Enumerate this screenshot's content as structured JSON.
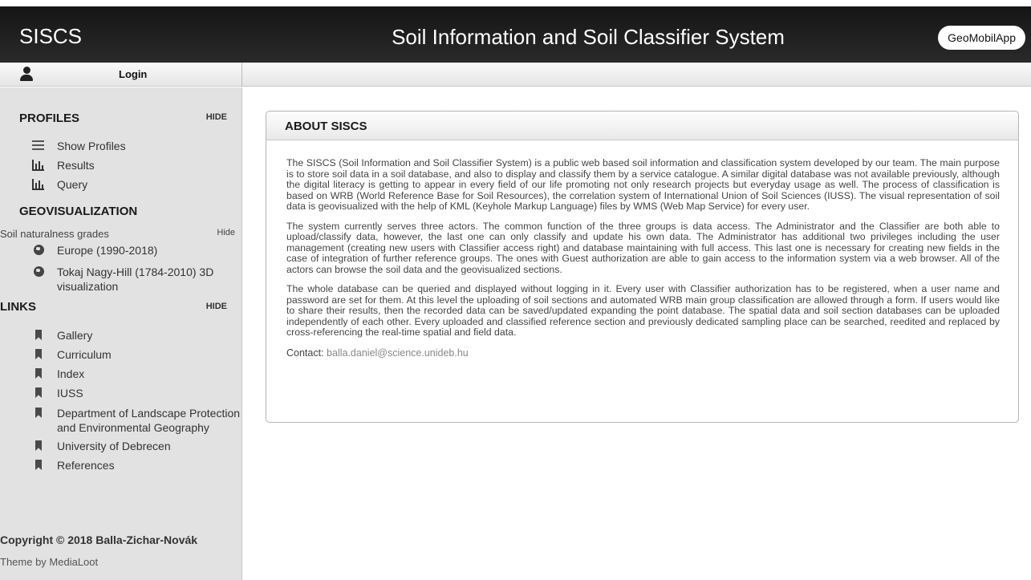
{
  "header": {
    "brand": "SISCS",
    "title": "Soil Information and Soil Classifier System",
    "geomobil_button": "GeoMobilApp"
  },
  "userbar": {
    "login_label": "Login"
  },
  "sidebar": {
    "profiles": {
      "heading": "PROFILES",
      "hide_label": "HIDE",
      "items": [
        {
          "label": "Show Profiles",
          "icon": "list-icon"
        },
        {
          "label": "Results",
          "icon": "bar-chart-icon"
        },
        {
          "label": "Query",
          "icon": "bar-chart-icon"
        }
      ]
    },
    "geovisualization": {
      "heading": "GEOVISUALIZATION",
      "group_label": "Soil naturalness grades",
      "hide_label": "Hide",
      "items": [
        {
          "label": "Europe (1990-2018)",
          "icon": "globe-icon"
        },
        {
          "label": "Tokaj Nagy-Hill (1784-2010) 3D visualization",
          "icon": "globe-icon"
        }
      ]
    },
    "links": {
      "heading": "LINKS",
      "hide_label": "HIDE",
      "items": [
        {
          "label": "Gallery",
          "icon": "bookmark-icon"
        },
        {
          "label": "Curriculum",
          "icon": "bookmark-icon"
        },
        {
          "label": "Index",
          "icon": "bookmark-icon"
        },
        {
          "label": "IUSS",
          "icon": "bookmark-icon"
        },
        {
          "label": "Department of Landscape Protection and Environmental Geography",
          "icon": "bookmark-icon"
        },
        {
          "label": "University of Debrecen",
          "icon": "bookmark-icon"
        },
        {
          "label": "References",
          "icon": "bookmark-icon"
        }
      ]
    },
    "footer": {
      "copyright": "Copyright © 2018 Balla-Zichar-Novák",
      "theme_by": "Theme by MediaLoot"
    }
  },
  "main": {
    "panel_title": "ABOUT SISCS",
    "paragraphs": [
      "The SISCS (Soil Information and Soil Classifier System) is a public web based soil information and classification system developed by our team. The main purpose is to store soil data in a soil database, and also to display and classify them by a service catalogue. A similar digital database was not available previously, although the digital literacy is getting to appear in every field of our life promoting not only research projects but everyday usage as well. The process of classification is based on WRB (World Reference Base for Soil Resources), the correlation system of International Union of Soil Sciences (IUSS). The visual representation of soil data is geovisualized with the help of KML (Keyhole Markup Language) files by WMS (Web Map Service) for every user.",
      "The system currently serves three actors. The common function of the three groups is data access. The Administrator and the Classifier are both able to upload/classify data, however, the last one can only classify and update his own data. The Administrator has additional two privileges including the user management (creating new users with Classifier access right) and database maintaining with full access. This last one is necessary for creating new fields in the case of integration of further reference groups. The ones with Guest authorization are able to gain access to the information system via a web browser. All of the actors can browse the soil data and the geovisualized sections.",
      "The whole database can be queried and displayed without logging in it. Every user with Classifier authorization has to be registered, when a user name and password are set for them. At this level the uploading of soil sections and automated WRB main group classification are allowed through a form. If users would like to share their results, then the recorded data can be saved/updated expanding the point database. The spatial data and soil section databases can be uploaded independently of each other. Every uploaded and classified reference section and previously dedicated sampling place can be searched, reedited and replaced by cross-referencing the real-time spatial and field data."
    ],
    "contact_label": "Contact:",
    "contact_email": "balla.daniel@science.unideb.hu"
  }
}
